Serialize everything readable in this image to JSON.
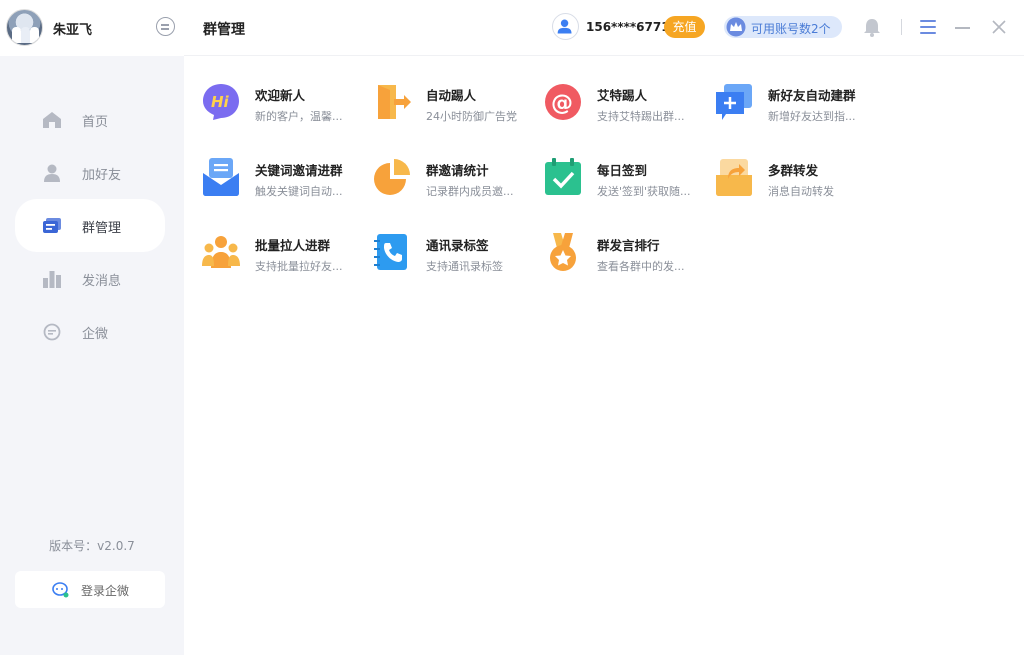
{
  "profile": {
    "name": "朱亚飞"
  },
  "nav": {
    "items": [
      {
        "label": "首页",
        "icon": "home-icon"
      },
      {
        "label": "加好友",
        "icon": "user-add-icon"
      },
      {
        "label": "群管理",
        "icon": "group-manage-icon",
        "active": true
      },
      {
        "label": "发消息",
        "icon": "bar-chart-icon"
      },
      {
        "label": "企微",
        "icon": "chat-bubble-icon"
      }
    ]
  },
  "version": "版本号：v2.0.7",
  "login_label": "登录企微",
  "header": {
    "title": "群管理",
    "account": "156****6771",
    "recharge": "充值",
    "available_accounts": "可用账号数2个"
  },
  "features": [
    {
      "name": "欢迎新人",
      "desc": "新的客户，温馨...",
      "icon": "hi-welcome-icon",
      "color": "#7b6cf0"
    },
    {
      "name": "自动踢人",
      "desc": "24小时防御广告党",
      "icon": "door-exit-icon",
      "color": "#f7a23b"
    },
    {
      "name": "艾特踢人",
      "desc": "支持艾特踢出群...",
      "icon": "at-sign-icon",
      "color": "#f05a62"
    },
    {
      "name": "新好友自动建群",
      "desc": "新增好友达到指...",
      "icon": "create-group-icon",
      "color": "#3b7ef2"
    },
    {
      "name": "关键词邀请进群",
      "desc": "触发关键词自动...",
      "icon": "envelope-icon",
      "color": "#3b7ef2"
    },
    {
      "name": "群邀请统计",
      "desc": "记录群内成员邀...",
      "icon": "pie-chart-icon",
      "color": "#f7a23b"
    },
    {
      "name": "每日签到",
      "desc": "发送'签到'获取随...",
      "icon": "calendar-check-icon",
      "color": "#2bc18f"
    },
    {
      "name": "多群转发",
      "desc": "消息自动转发",
      "icon": "forward-box-icon",
      "color": "#f7b84b"
    },
    {
      "name": "批量拉人进群",
      "desc": "支持批量拉好友...",
      "icon": "people-group-icon",
      "color": "#f7a23b"
    },
    {
      "name": "通讯录标签",
      "desc": "支持通讯录标签",
      "icon": "contact-book-icon",
      "color": "#2d9bf0"
    },
    {
      "name": "群发言排行",
      "desc": "查看各群中的发...",
      "icon": "medal-icon",
      "color": "#f7a23b"
    }
  ]
}
